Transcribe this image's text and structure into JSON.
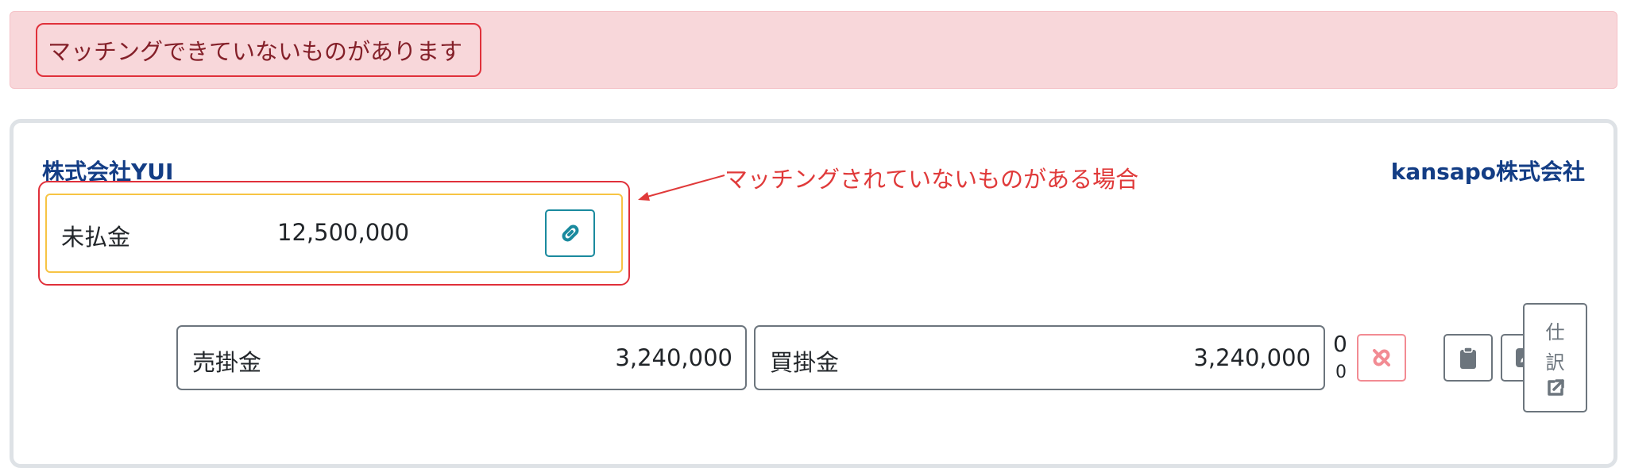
{
  "alert": {
    "message": "マッチングできていないものがあります"
  },
  "header": {
    "left_company": "株式会社YUI",
    "right_company": "kansapo株式会社"
  },
  "annotation": {
    "text": "マッチングされていないものがある場合",
    "color": "#e03a3a"
  },
  "unmatched_account": {
    "name": "未払金",
    "amount": "12,500,000",
    "link_icon": "link-icon"
  },
  "matched_row": {
    "left": {
      "name": "売掛金",
      "amount": "3,240,000"
    },
    "right": {
      "name": "買掛金",
      "amount": "3,240,000"
    },
    "difference_top": "0",
    "difference_bottom": "0",
    "unlink_icon": "unlink-icon",
    "clipboard_icon": "clipboard-icon",
    "edit_icon": "edit-icon",
    "journal": {
      "line1": "仕",
      "line2": "訳",
      "icon": "external-link-icon"
    }
  },
  "colors": {
    "alert_bg": "#f8d7da",
    "alert_text": "#842029",
    "highlight_red": "#e0303a",
    "company_blue": "#133d85",
    "unmatched_border": "#f7c444",
    "link_teal": "#1a8a9e",
    "unlink_pink": "#f28b93"
  }
}
